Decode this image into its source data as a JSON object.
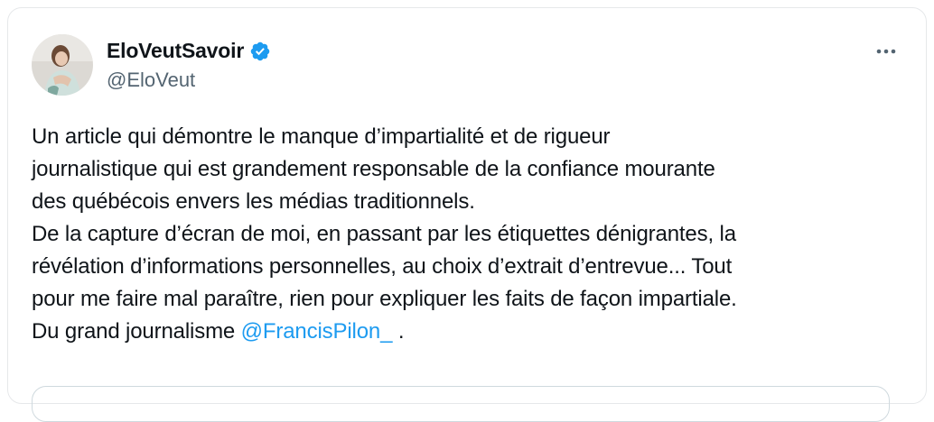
{
  "author": {
    "display_name": "EloVeutSavoir",
    "handle": "@EloVeut",
    "verified": true,
    "avatar_icon": "profile-photo"
  },
  "more_icon": "more-horizontal-icon",
  "tweet": {
    "lines": [
      "Un article qui démontre le manque d’impartialité et de rigueur",
      "journalistique qui est grandement responsable de la confiance mourante",
      "des québécois envers les médias traditionnels.",
      "De la capture d’écran de moi, en passant par les étiquettes dénigrantes, la",
      "révélation d’informations personnelles, au choix d’extrait d’entrevue... Tout",
      "pour me faire mal paraître, rien pour expliquer les faits de façon impartiale."
    ],
    "last_line_prefix": "Du grand journalisme ",
    "mention": "@FrancisPilon_",
    "last_line_suffix": " ."
  },
  "colors": {
    "text": "#0f1419",
    "secondary": "#536471",
    "accent": "#1d9bf0"
  }
}
